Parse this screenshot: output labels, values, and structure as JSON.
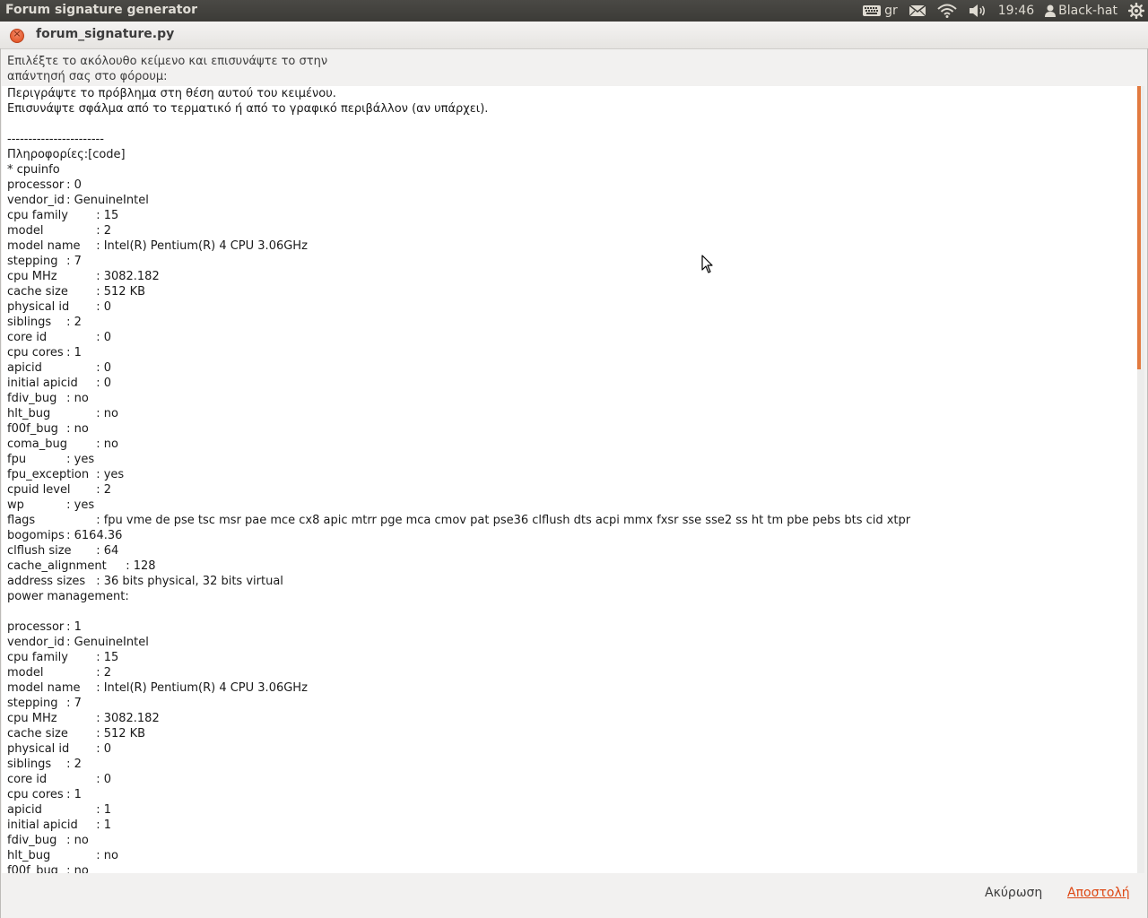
{
  "panel": {
    "app_title": "Forum signature generator",
    "keyboard_layout": "gr",
    "clock": "19:46",
    "user": "Black-hat",
    "icons": [
      "keyboard-icon",
      "mail-icon",
      "wifi-icon",
      "volume-icon",
      "user-icon",
      "gear-icon"
    ]
  },
  "window": {
    "title": "forum_signature.py",
    "close_glyph": "×"
  },
  "instruction": "Επιλέξτε το ακόλουθο κείμενο και επισυνάψτε το στην απάντησή σας στο φόρουμ:",
  "text_content": "Περιγράψτε το πρόβλημα στη θέση αυτού του κειμένου.\nΕπισυνάψτε σφάλμα από το τερματικό ή από το γραφικό περιβάλλον (αν υπάρχει).\n\n-----------------------\nΠληροφορίες:[code]\n* cpuinfo\nprocessor\t: 0\nvendor_id\t: GenuineIntel\ncpu family\t: 15\nmodel\t\t: 2\nmodel name\t: Intel(R) Pentium(R) 4 CPU 3.06GHz\nstepping\t: 7\ncpu MHz\t\t: 3082.182\ncache size\t: 512 KB\nphysical id\t: 0\nsiblings\t: 2\ncore id\t\t: 0\ncpu cores\t: 1\napicid\t\t: 0\ninitial apicid\t: 0\nfdiv_bug\t: no\nhlt_bug\t\t: no\nf00f_bug\t: no\ncoma_bug\t: no\nfpu\t\t: yes\nfpu_exception\t: yes\ncpuid level\t: 2\nwp\t\t: yes\nflags\t\t: fpu vme de pse tsc msr pae mce cx8 apic mtrr pge mca cmov pat pse36 clflush dts acpi mmx fxsr sse sse2 ss ht tm pbe pebs bts cid xtpr\nbogomips\t: 6164.36\nclflush size\t: 64\ncache_alignment\t: 128\naddress sizes\t: 36 bits physical, 32 bits virtual\npower management:\n\nprocessor\t: 1\nvendor_id\t: GenuineIntel\ncpu family\t: 15\nmodel\t\t: 2\nmodel name\t: Intel(R) Pentium(R) 4 CPU 3.06GHz\nstepping\t: 7\ncpu MHz\t\t: 3082.182\ncache size\t: 512 KB\nphysical id\t: 0\nsiblings\t: 2\ncore id\t\t: 0\ncpu cores\t: 1\napicid\t\t: 1\ninitial apicid\t: 1\nfdiv_bug\t: no\nhlt_bug\t\t: no\nf00f_bug\t: no",
  "buttons": {
    "cancel": "Ακύρωση",
    "send": "Αποστολή"
  },
  "colors": {
    "accent": "#dd4814",
    "scroll_thumb": "#e27a3f",
    "panel_bg": "#3c3b37"
  }
}
